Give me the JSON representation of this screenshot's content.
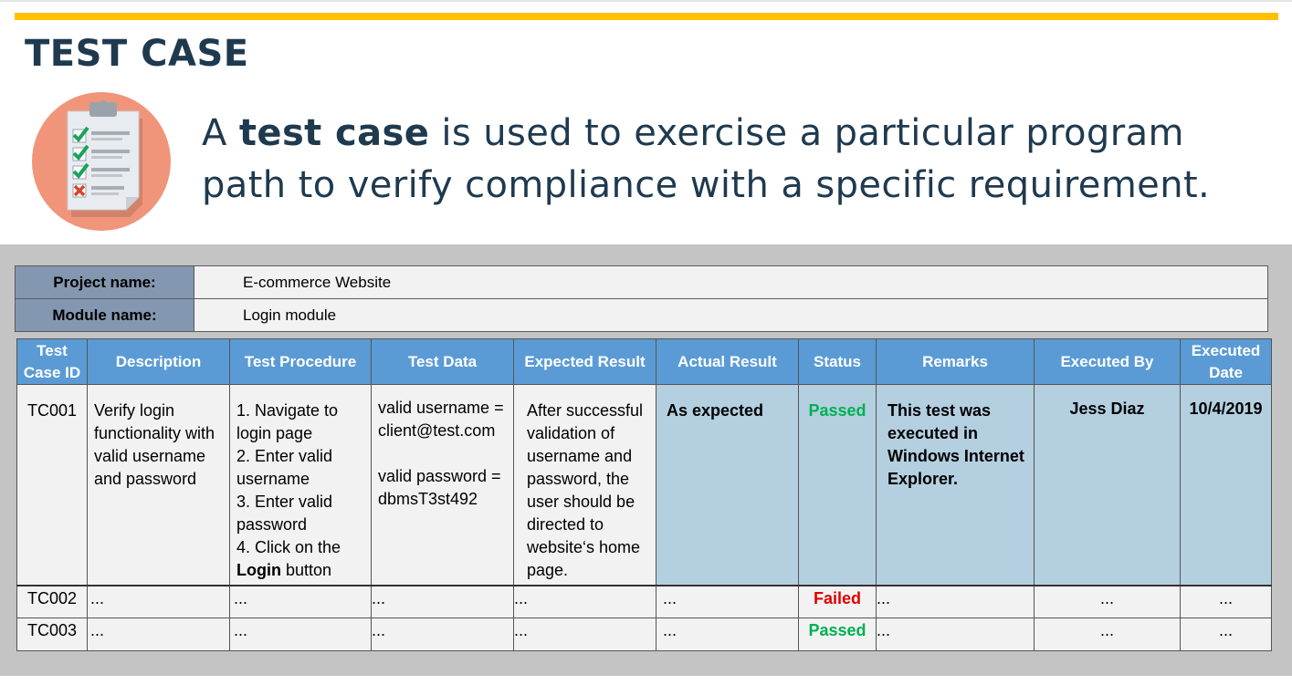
{
  "slide": {
    "title": "TEST CASE",
    "lead_pre": "A ",
    "lead_bold": "test case",
    "lead_post": " is used to exercise a particular program path to verify compliance with a specific requirement."
  },
  "icon": "clipboard-checklist-icon",
  "colors": {
    "accent_bar": "#ffc000",
    "header_blue": "#5b9bd5",
    "cell_blue": "#b4d0e0",
    "meta_label": "#8497b0",
    "passed": "#00b050",
    "failed": "#e00000"
  },
  "meta": {
    "project_label": "Project name:",
    "project_value": "E-commerce Website",
    "module_label": "Module name:",
    "module_value": "Login module"
  },
  "table": {
    "headers": [
      "Test Case ID",
      "Description",
      "Test Procedure",
      "Test Data",
      "Expected Result",
      "Actual Result",
      "Status",
      "Remarks",
      "Executed By",
      "Executed Date"
    ],
    "headers_split": [
      [
        "Test",
        "Case ID"
      ],
      [
        "Executed",
        "Date"
      ]
    ],
    "rows": [
      {
        "id": "TC001",
        "description": "Verify login functionality with valid username and password",
        "procedure": [
          "1. Navigate to login page",
          "2. Enter valid username",
          "3. Enter valid password",
          "4. Click on the "
        ],
        "procedure_bold": "Login",
        "procedure_tail": " button",
        "data": [
          "valid username = client@test.com",
          "valid password = dbmsT3st492"
        ],
        "expected": "After successful validation of username and password, the user should be directed to website‘s home page.",
        "actual": "As expected",
        "status": "Passed",
        "remarks": "This test was executed in Windows Internet Explorer.",
        "executed_by": "Jess Diaz",
        "executed_date": "10/4/2019"
      },
      {
        "id": "TC002",
        "description": "...",
        "procedure": "...",
        "data": "...",
        "expected": "...",
        "actual": "...",
        "status": "Failed",
        "remarks": "...",
        "executed_by": "...",
        "executed_date": "..."
      },
      {
        "id": "TC003",
        "description": "...",
        "procedure": "...",
        "data": "...",
        "expected": "...",
        "actual": "...",
        "status": "Passed",
        "remarks": "...",
        "executed_by": "...",
        "executed_date": "..."
      }
    ]
  }
}
